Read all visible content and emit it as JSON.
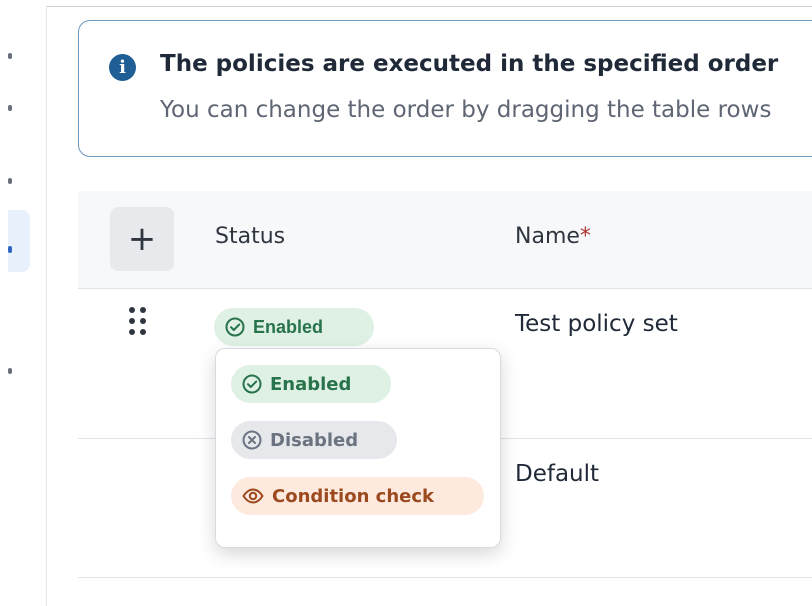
{
  "banner": {
    "title": "The policies are executed in the specified order",
    "text": "You can change the order by dragging the table rows",
    "icon": "info-icon"
  },
  "table": {
    "add_button": "+",
    "headers": {
      "status": "Status",
      "name": "Name",
      "required_mark": "*"
    },
    "rows": [
      {
        "status": "Enabled",
        "name": "Test policy set"
      },
      {
        "status": "",
        "name": "Default"
      }
    ]
  },
  "status_menu": {
    "options": [
      {
        "label": "Enabled",
        "icon": "check-circle-icon"
      },
      {
        "label": "Disabled",
        "icon": "x-circle-icon"
      },
      {
        "label": "Condition check",
        "icon": "eye-icon"
      }
    ]
  },
  "colors": {
    "accent": "#1f5f96",
    "enabled_bg": "#dff1e5",
    "enabled_text": "#28734b",
    "disabled_bg": "#e6e8eb",
    "disabled_text": "#6b7280",
    "condition_bg": "#fde9de",
    "condition_text": "#9b4a1f",
    "required": "#b4322f"
  }
}
